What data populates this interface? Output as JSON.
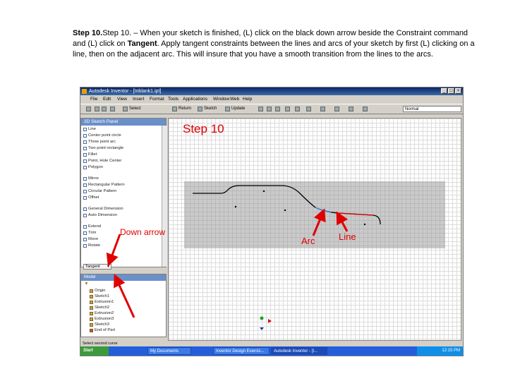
{
  "instructions": {
    "p1": "Step 10. – When your sketch is finished, (L) click on the black down arrow beside the Constraint command and (L) click on ",
    "tangent": "Tangent",
    "p2": ". Apply tangent constraints between the lines and arcs of your sketch by first (L) clicking on a line, then on the adjacent arc. This will insure that you have a smooth transition from the lines to the arcs."
  },
  "app": {
    "title": "Autodesk Inventor - [Inblank1.ipt]",
    "menu": [
      "File",
      "Edit",
      "View",
      "Insert",
      "Format",
      "Tools",
      "Applications",
      "Window",
      "Web",
      "Help"
    ],
    "toolbar": {
      "select_label": "Select",
      "return_label": "Return",
      "sketch_label": "Sketch",
      "update_label": "Update",
      "style_value": "Normal"
    },
    "panel": {
      "title": "2D Sketch Panel",
      "items": [
        "Line",
        "Center point circle",
        "Three point arc",
        "Two point rectangle",
        "Fillet",
        "Point, Hole Center",
        "Polygon",
        "Mirror",
        "Rectangular Pattern",
        "Circular Pattern",
        "Offset",
        "General Dimension",
        "Auto Dimension",
        "Extend",
        "Trim",
        "Move",
        "Rotate"
      ],
      "dropdown_value": "Tangent"
    },
    "browser": {
      "title": "Model",
      "items": [
        "Origin",
        "Sketch1",
        "Extrusion1",
        "Sketch2",
        "Extrusion2",
        "Extrusion3",
        "Sketch3",
        "End of Part"
      ]
    },
    "status_text": "Select second curve",
    "taskbar": {
      "start": "Start",
      "items": [
        "My Documents",
        "Inventor Design Exercis...",
        "Autodesk Inventor - [I..."
      ],
      "clock": "12:15 PM"
    }
  },
  "annotations": {
    "step": "Step 10",
    "down_arrow": "Down arrow",
    "arc": "Arc",
    "line": "Line",
    "color": "#e00000"
  }
}
